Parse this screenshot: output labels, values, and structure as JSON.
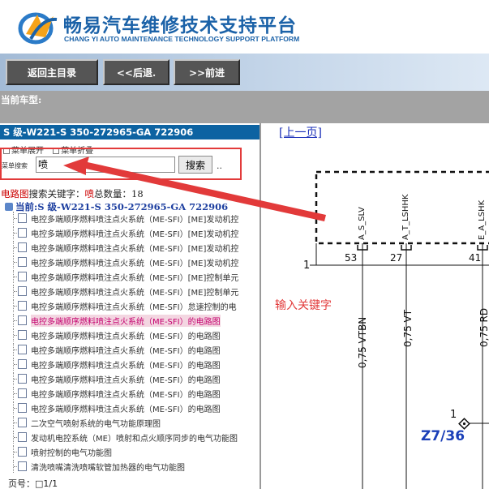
{
  "header": {
    "title": "畅易汽车维修技术支持平台",
    "subtitle": "CHANG YI AUTO MAINTENANCE TECHNOLOGY SUPPORT PLATFORM"
  },
  "nav": {
    "home": "返回主目录",
    "back": "<<后退.",
    "forward": ">>前进"
  },
  "car_label": "当前车型:",
  "left": {
    "model": "S 级-W221-S 350-272965-GA 722906",
    "expand": "菜单展开",
    "collapse": "菜单折叠",
    "search_label": "菜单搜索",
    "search_value": "喷",
    "search_button": "搜索",
    "search_dots": "..",
    "result_prefix": "电路图",
    "result_mid": "搜索关键字：",
    "result_keyword": "喷",
    "result_count_label": "总数量：",
    "result_count": "18",
    "current": "当前:S 级-W221-S 350-272965-GA 722906",
    "items": [
      "电控多端顺序燃料喷注点火系统（ME-SFI）[ME]发动机控",
      "电控多端顺序燃料喷注点火系统（ME-SFI）[ME]发动机控",
      "电控多端顺序燃料喷注点火系统（ME-SFI）[ME]发动机控",
      "电控多端顺序燃料喷注点火系统（ME-SFI）[ME]发动机控",
      "电控多端顺序燃料喷注点火系统（ME-SFI）[ME]控制单元",
      "电控多端顺序燃料喷注点火系统（ME-SFI）[ME]控制单元",
      "电控多端顺序燃料喷注点火系统（ME-SFI）怠速控制的电",
      "电控多端顺序燃料喷注点火系统（ME-SFI）的电路图",
      "电控多端顺序燃料喷注点火系统（ME-SFI）的电路图",
      "电控多端顺序燃料喷注点火系统（ME-SFI）的电路图",
      "电控多端顺序燃料喷注点火系统（ME-SFI）的电路图",
      "电控多端顺序燃料喷注点火系统（ME-SFI）的电路图",
      "电控多端顺序燃料喷注点火系统（ME-SFI）的电路图",
      "电控多端顺序燃料喷注点火系统（ME-SFI）的电路图",
      "二次空气喷射系统的电气功能原理图",
      "发动机电控系统（ME）喷射和点火顺序同步的电气功能图",
      "喷射控制的电气功能图",
      "清洗喷嘴清洗喷嘴软管加热器的电气功能图"
    ],
    "selected_index": 7,
    "pager": "页号：□1/1"
  },
  "right": {
    "prev_link": "[上一页]",
    "annotation": "输入关键字",
    "label_one_a": "1",
    "label_one_b": "1",
    "pins": [
      "53",
      "27",
      "41"
    ],
    "signals": [
      "A_S_SLV",
      "A_T_LSHHK",
      "E_A_LSHK"
    ],
    "wires": [
      "0,75 VTBN",
      "0,75 VT",
      "0,75 RD"
    ],
    "connector_ref": "Z7/36"
  },
  "colors": {
    "brand_blue": "#1b62a8",
    "model_bar": "#0d63a2",
    "highlight": "#e23a3a",
    "selected_text": "#c4006e"
  }
}
